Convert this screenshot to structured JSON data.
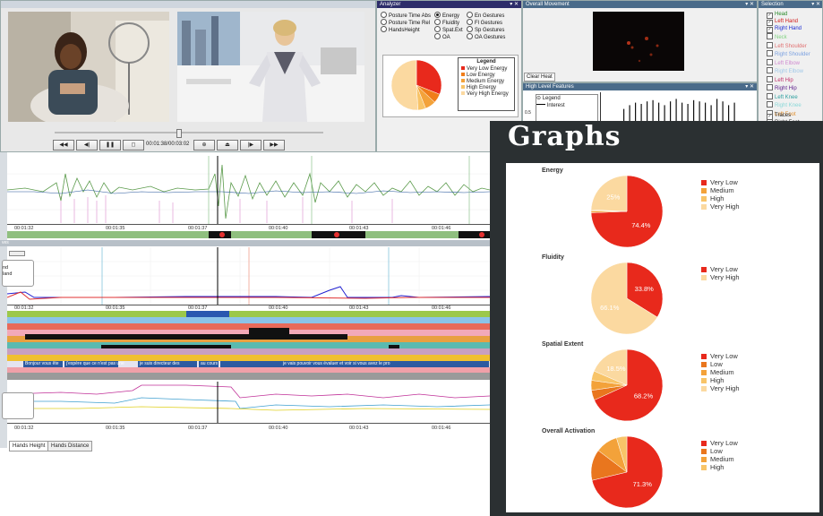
{
  "player": {
    "time": "00:01:38/00:03:02",
    "buttons": [
      "◀◀",
      "◀|",
      "❚❚",
      "◻",
      "⊕",
      "⏏",
      "|▶",
      "▶▶"
    ]
  },
  "analyzer": {
    "title": "Analyzer",
    "options_left": [
      "Posture Time Abs",
      "Posture Time Rel",
      "HandsHeight"
    ],
    "options_mid": [
      "Energy",
      "Fluidity",
      "Spat.Ext",
      "OA"
    ],
    "options_right": [
      "En Gestures",
      "Fl Gestures",
      "Sp Gestures",
      "OA Gestures"
    ],
    "legend_title": "Legend",
    "legend": [
      {
        "label": "Very Low Energy",
        "color": "#e8291c"
      },
      {
        "label": "Low Energy",
        "color": "#f07d1a"
      },
      {
        "label": "Medium Energy",
        "color": "#f3a23a"
      },
      {
        "label": "High Energy",
        "color": "#f8c468"
      },
      {
        "label": "Very High Energy",
        "color": "#fbd9a0"
      }
    ],
    "pie": [
      0.31,
      0.06,
      0.07,
      0.05,
      0.51
    ]
  },
  "overall": {
    "title": "Overall Movement",
    "clear_label": "Clear Heat"
  },
  "hlf": {
    "title": "High Level Features",
    "legend_label": "Legend",
    "interest_label": "Interest",
    "axis_tick": "0.5",
    "bars": [
      0.55,
      0.7,
      0.8,
      0.75,
      0.85,
      0.9,
      0.8,
      0.7,
      0.85,
      0.95,
      0.8,
      0.75,
      0.9,
      0.85,
      0.8,
      0.7,
      0.95,
      0.85,
      0.7,
      0.8
    ]
  },
  "selection": {
    "title": "Selection",
    "items": [
      {
        "label": "Head",
        "checked": true,
        "color": "#2a8a2a"
      },
      {
        "label": "Left Hand",
        "checked": true,
        "color": "#d21b1b"
      },
      {
        "label": "Right Hand",
        "checked": true,
        "color": "#1b2bd2"
      },
      {
        "label": "Neck",
        "checked": false,
        "color": "#7fd27f"
      },
      {
        "label": "Left Shoulder",
        "checked": false,
        "color": "#e07070"
      },
      {
        "label": "Right Shoulder",
        "checked": false,
        "color": "#7aa0e0"
      },
      {
        "label": "Left Elbow",
        "checked": false,
        "color": "#d08ad0"
      },
      {
        "label": "Right Elbow",
        "checked": false,
        "color": "#a0c8e8"
      },
      {
        "label": "Left Hip",
        "checked": false,
        "color": "#c0306a"
      },
      {
        "label": "Right Hip",
        "checked": false,
        "color": "#5a1a8a"
      },
      {
        "label": "Left Knee",
        "checked": false,
        "color": "#30a0a0"
      },
      {
        "label": "Right Knee",
        "checked": false,
        "color": "#8ad8d8"
      },
      {
        "label": "Left Foot",
        "checked": false,
        "color": "#e09030"
      },
      {
        "label": "Right Foot",
        "checked": false,
        "color": "#333333"
      },
      {
        "label": "Torso",
        "checked": false,
        "color": "#e0c030"
      }
    ],
    "traces_label": "Traces"
  },
  "timeline": {
    "ticks_a": [
      "00:01:32",
      "00:01:35",
      "00:01:37",
      "00:01:40",
      "00:01:43",
      "00:01:46"
    ],
    "ticks_b": [
      "00:01:32",
      "00:01:35",
      "00:01:37",
      "00:01:40",
      "00:01:43",
      "00:01:46"
    ],
    "ticks_c": [
      "00:01:32",
      "00:01:35",
      "00:01:37",
      "00:01:40",
      "00:01:43",
      "00:01:46"
    ],
    "section_label": "ves",
    "legend_box_lines": [
      "nd",
      "land"
    ],
    "subtitles": [
      "Bonjour vous ête",
      "j'espère que ce n'est pas une",
      "je suis directeur des",
      "au cours",
      "je vais pouvoir vous évaluer et voir si vous avez le pro"
    ],
    "tabs": [
      "Hands Height",
      "Hands Distance"
    ]
  },
  "graphs": {
    "title": "Graphs",
    "charts": [
      {
        "title": "Energy",
        "legend": [
          "Very Low",
          "Medium",
          "High",
          "Very High"
        ],
        "colors": [
          "#e8291c",
          "#f3a23a",
          "#f8c468",
          "#fbd9a0"
        ],
        "values": [
          74.4,
          0.8,
          0.5,
          24.3
        ],
        "labels": [
          "74.4%",
          "",
          "",
          "25%"
        ]
      },
      {
        "title": "Fluidity",
        "legend": [
          "Very Low",
          "Very High"
        ],
        "colors": [
          "#e8291c",
          "#fbd9a0"
        ],
        "values": [
          33.8,
          66.1
        ],
        "labels": [
          "33.8%",
          "66.1%"
        ]
      },
      {
        "title": "Spatial Extent",
        "legend": [
          "Very Low",
          "Low",
          "Medium",
          "High",
          "Very High"
        ],
        "colors": [
          "#e8291c",
          "#e9761e",
          "#f3a23a",
          "#f8c468",
          "#fbd9a0"
        ],
        "values": [
          68.2,
          4.5,
          4.5,
          4.3,
          18.5
        ],
        "labels": [
          "68.2%",
          "",
          "",
          "",
          "18.5%"
        ]
      },
      {
        "title": "Overall Activation",
        "legend": [
          "Very Low",
          "Low",
          "Medium",
          "High"
        ],
        "colors": [
          "#e8291c",
          "#e9761e",
          "#f3a23a",
          "#f8c468"
        ],
        "values": [
          71.3,
          14.0,
          10.0,
          4.7
        ],
        "labels": [
          "71.3%",
          "",
          "",
          ""
        ]
      }
    ]
  }
}
